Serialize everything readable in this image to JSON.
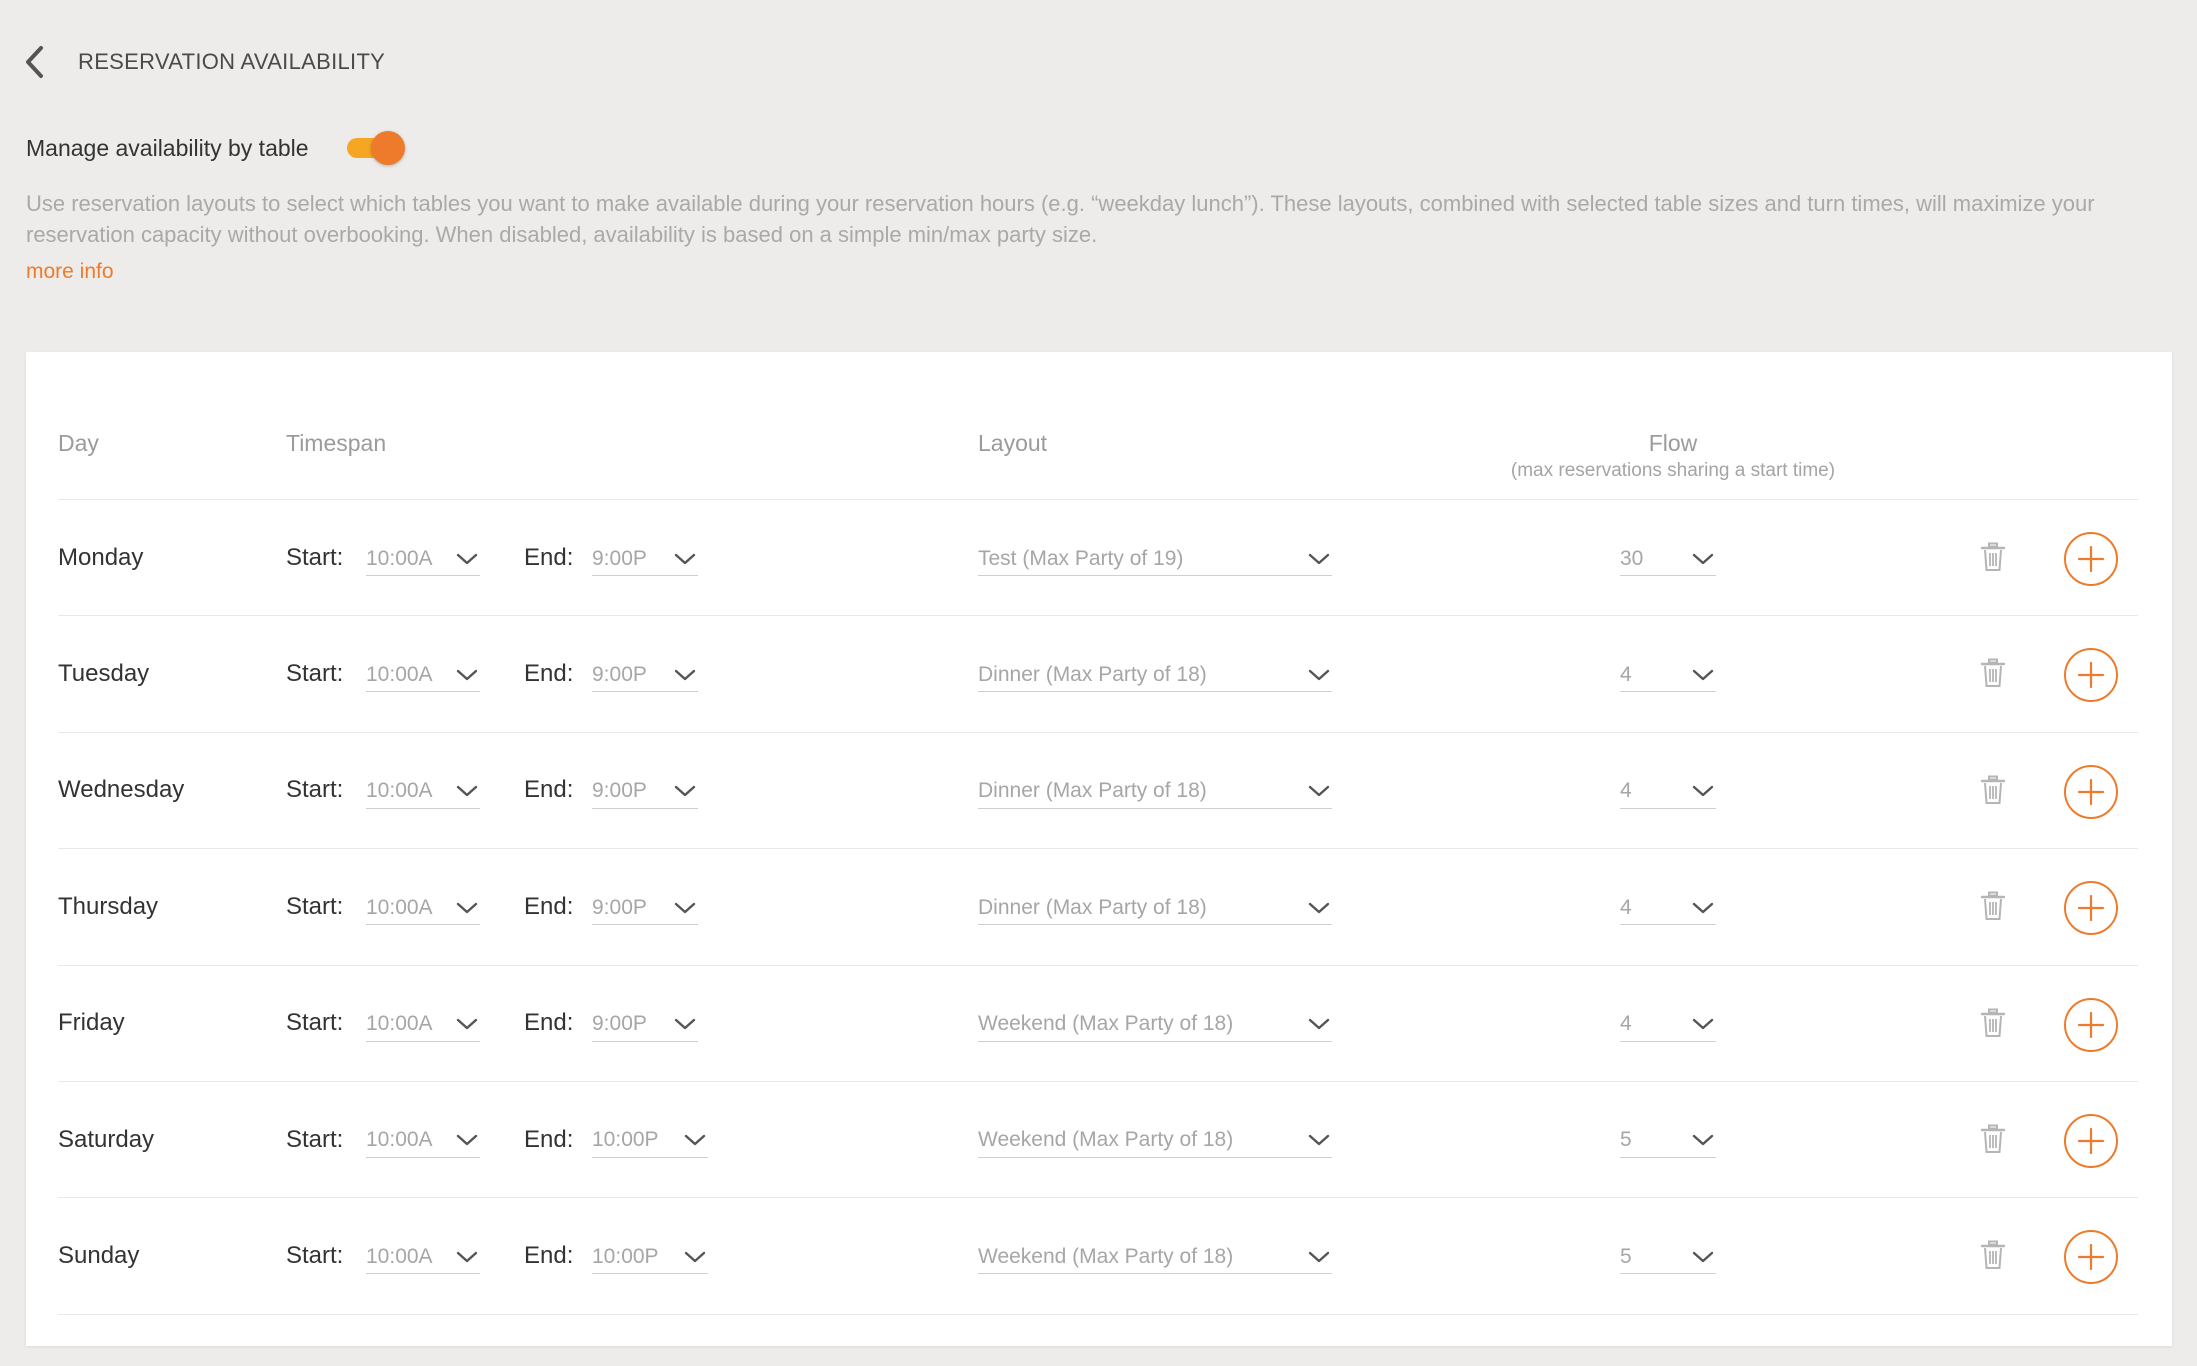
{
  "header": {
    "title": "RESERVATION AVAILABILITY"
  },
  "toggle": {
    "label": "Manage availability by table",
    "enabled": true
  },
  "description": "Use reservation layouts to select which tables you want to make available during your reservation hours (e.g. “weekday lunch”). These layouts, combined with selected table sizes and turn times, will maximize your reservation capacity without overbooking. When disabled, availability is based on a simple min/max party size.",
  "more_info": "more info",
  "table": {
    "columns": {
      "day": "Day",
      "timespan": "Timespan",
      "layout": "Layout",
      "flow": "Flow",
      "flow_sub": "(max reservations sharing a start time)"
    },
    "start_label": "Start:",
    "end_label": "End:",
    "rows": [
      {
        "day": "Monday",
        "start": "10:00A",
        "end": "9:00P",
        "layout": "Test (Max Party of 19)",
        "flow": "30"
      },
      {
        "day": "Tuesday",
        "start": "10:00A",
        "end": "9:00P",
        "layout": "Dinner (Max Party of 18)",
        "flow": "4"
      },
      {
        "day": "Wednesday",
        "start": "10:00A",
        "end": "9:00P",
        "layout": "Dinner (Max Party of 18)",
        "flow": "4"
      },
      {
        "day": "Thursday",
        "start": "10:00A",
        "end": "9:00P",
        "layout": "Dinner (Max Party of 18)",
        "flow": "4"
      },
      {
        "day": "Friday",
        "start": "10:00A",
        "end": "9:00P",
        "layout": "Weekend (Max Party of 18)",
        "flow": "4"
      },
      {
        "day": "Saturday",
        "start": "10:00A",
        "end": "10:00P",
        "layout": "Weekend (Max Party of 18)",
        "flow": "5"
      },
      {
        "day": "Sunday",
        "start": "10:00A",
        "end": "10:00P",
        "layout": "Weekend (Max Party of 18)",
        "flow": "5"
      }
    ]
  },
  "colors": {
    "accent": "#ee7b2b",
    "toggle_track": "#f5a623",
    "background": "#edeceb"
  },
  "icons": {
    "back": "chevron-left-icon",
    "dropdown": "chevron-down-icon",
    "delete": "trash-icon",
    "add": "plus-circle-icon"
  }
}
